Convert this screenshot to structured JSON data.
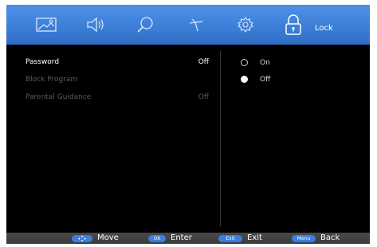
{
  "topbar": {
    "tabs": [
      {
        "icon": "picture-icon"
      },
      {
        "icon": "speaker-icon"
      },
      {
        "icon": "search-icon"
      },
      {
        "icon": "antenna-icon"
      },
      {
        "icon": "gear-icon"
      },
      {
        "icon": "lock-icon"
      }
    ],
    "active_label": "Lock"
  },
  "menu": {
    "rows": [
      {
        "label": "Password",
        "value": "Off"
      },
      {
        "label": "Block Program",
        "value": ""
      },
      {
        "label": "Parental Guidance",
        "value": "Off"
      }
    ],
    "options": [
      {
        "label": "On",
        "selected": false
      },
      {
        "label": "Off",
        "selected": true
      }
    ]
  },
  "footer": {
    "hints": [
      {
        "key": "",
        "label": "Move"
      },
      {
        "key": "OK",
        "label": "Enter"
      },
      {
        "key": "Exit",
        "label": "Exit"
      },
      {
        "key": "Menu",
        "label": "Back"
      }
    ]
  },
  "colors": {
    "accent": "#3d7fd8",
    "background": "#000000",
    "footer": "#404040"
  }
}
